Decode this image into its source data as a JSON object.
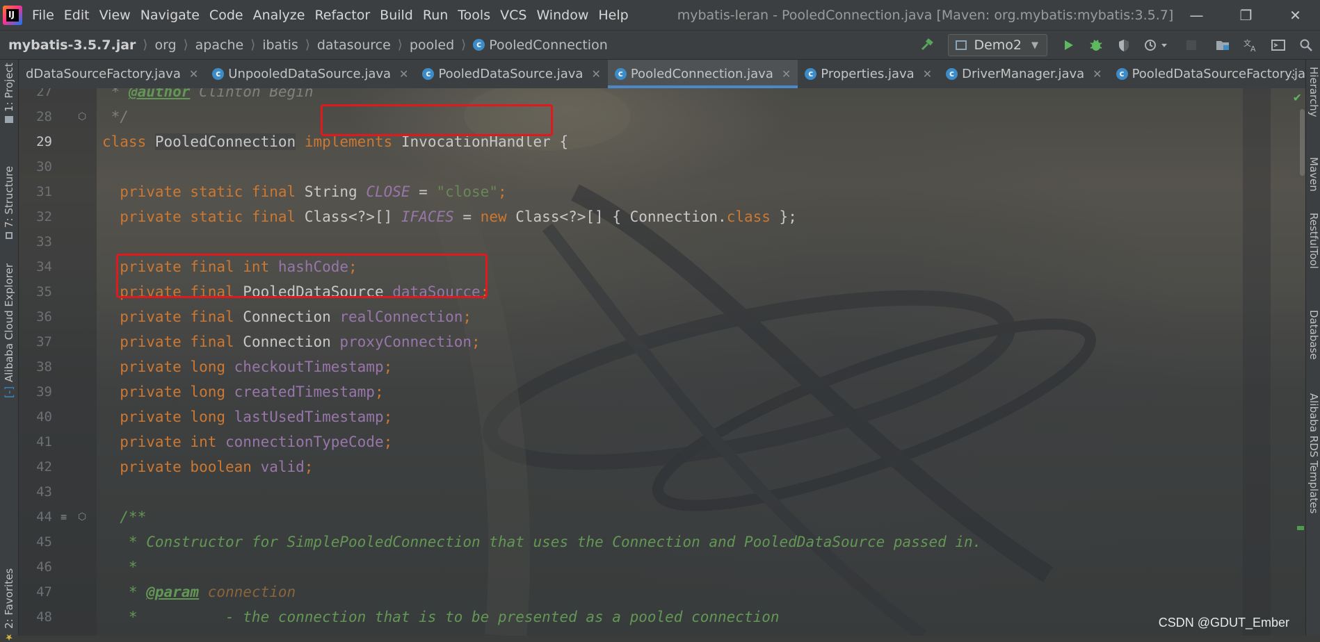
{
  "app": {
    "logo_text": "IJ",
    "window_title": "mybatis-leran - PooledConnection.java [Maven: org.mybatis:mybatis:3.5.7]"
  },
  "menu": [
    "File",
    "Edit",
    "View",
    "Navigate",
    "Code",
    "Analyze",
    "Refactor",
    "Build",
    "Run",
    "Tools",
    "VCS",
    "Window",
    "Help"
  ],
  "window_controls": {
    "minimize": "—",
    "restore": "❐",
    "close": "✕"
  },
  "breadcrumb": [
    "mybatis-3.5.7.jar",
    "org",
    "apache",
    "ibatis",
    "datasource",
    "pooled",
    "PooledConnection"
  ],
  "toolbar": {
    "run_config": "Demo2"
  },
  "left_tool_tabs": [
    "1: Project",
    "7: Structure",
    "Alibaba Cloud Explorer",
    "2: Favorites"
  ],
  "right_tool_tabs": [
    "Hierarchy",
    "Maven",
    "RestfulTool",
    "Database",
    "Alibaba RDS Templates"
  ],
  "tabs": [
    {
      "label": "dDataSourceFactory.java",
      "active": false,
      "icon": false
    },
    {
      "label": "UnpooledDataSource.java",
      "active": false,
      "icon": true
    },
    {
      "label": "PooledDataSource.java",
      "active": false,
      "icon": true
    },
    {
      "label": "PooledConnection.java",
      "active": true,
      "icon": true
    },
    {
      "label": "Properties.java",
      "active": false,
      "icon": true
    },
    {
      "label": "DriverManager.java",
      "active": false,
      "icon": true
    },
    {
      "label": "PooledDataSourceFactory.ja",
      "active": false,
      "icon": true
    }
  ],
  "editor": {
    "current_line": 29,
    "lines": [
      {
        "n": "27",
        "parts": [
          [
            "dgray",
            " * "
          ],
          [
            "dtag",
            "@author"
          ],
          [
            "dgray",
            " Clinton Begin"
          ]
        ]
      },
      {
        "n": "28",
        "parts": [
          [
            "dgray",
            " */"
          ]
        ]
      },
      {
        "n": "29",
        "parts": [
          [
            "kw",
            "class "
          ],
          [
            "cls-name",
            "PooledConnection"
          ],
          [
            "plain",
            " "
          ],
          [
            "kw",
            "implements "
          ],
          [
            "ty",
            "InvocationHandler"
          ],
          [
            "plain",
            " {"
          ]
        ]
      },
      {
        "n": "30",
        "parts": []
      },
      {
        "n": "31",
        "parts": [
          [
            "kw",
            "  private static final "
          ],
          [
            "ty",
            "String "
          ],
          [
            "cst",
            "CLOSE"
          ],
          [
            "plain",
            " = "
          ],
          [
            "str",
            "\"close\""
          ],
          [
            "kw",
            ";"
          ]
        ]
      },
      {
        "n": "32",
        "parts": [
          [
            "kw",
            "  private static final "
          ],
          [
            "ty",
            "Class<?>[] "
          ],
          [
            "cst",
            "IFACES"
          ],
          [
            "plain",
            " = "
          ],
          [
            "kw",
            "new "
          ],
          [
            "ty",
            "Class<?>[] { Connection."
          ],
          [
            "kw",
            "class"
          ],
          [
            "plain",
            " };"
          ]
        ]
      },
      {
        "n": "33",
        "parts": []
      },
      {
        "n": "34",
        "parts": [
          [
            "kw",
            "  private final int "
          ],
          [
            "fld",
            "hashCode"
          ],
          [
            "kw",
            ";"
          ]
        ]
      },
      {
        "n": "35",
        "parts": [
          [
            "kw",
            "  private final "
          ],
          [
            "ty",
            "PooledDataSource "
          ],
          [
            "fld",
            "dataSource"
          ],
          [
            "kw",
            ";"
          ]
        ]
      },
      {
        "n": "36",
        "parts": [
          [
            "kw",
            "  private final "
          ],
          [
            "ty",
            "Connection "
          ],
          [
            "fld",
            "realConnection"
          ],
          [
            "kw",
            ";"
          ]
        ]
      },
      {
        "n": "37",
        "parts": [
          [
            "kw",
            "  private final "
          ],
          [
            "ty",
            "Connection "
          ],
          [
            "fld",
            "proxyConnection"
          ],
          [
            "kw",
            ";"
          ]
        ]
      },
      {
        "n": "38",
        "parts": [
          [
            "kw",
            "  private long "
          ],
          [
            "fld",
            "checkoutTimestamp"
          ],
          [
            "kw",
            ";"
          ]
        ]
      },
      {
        "n": "39",
        "parts": [
          [
            "kw",
            "  private long "
          ],
          [
            "fld",
            "createdTimestamp"
          ],
          [
            "kw",
            ";"
          ]
        ]
      },
      {
        "n": "40",
        "parts": [
          [
            "kw",
            "  private long "
          ],
          [
            "fld",
            "lastUsedTimestamp"
          ],
          [
            "kw",
            ";"
          ]
        ]
      },
      {
        "n": "41",
        "parts": [
          [
            "kw",
            "  private int "
          ],
          [
            "fld",
            "connectionTypeCode"
          ],
          [
            "kw",
            ";"
          ]
        ]
      },
      {
        "n": "42",
        "parts": [
          [
            "kw",
            "  private boolean "
          ],
          [
            "fld",
            "valid"
          ],
          [
            "kw",
            ";"
          ]
        ]
      },
      {
        "n": "43",
        "parts": []
      },
      {
        "n": "44",
        "parts": [
          [
            "doc",
            "  /**"
          ]
        ]
      },
      {
        "n": "45",
        "parts": [
          [
            "doc",
            "   * Constructor for SimplePooledConnection that uses the Connection and PooledDataSource passed in."
          ]
        ]
      },
      {
        "n": "46",
        "parts": [
          [
            "doc",
            "   *"
          ]
        ]
      },
      {
        "n": "47",
        "parts": [
          [
            "doc",
            "   * "
          ],
          [
            "dtag",
            "@param"
          ],
          [
            "doc",
            " "
          ],
          [
            "dparam",
            "connection"
          ]
        ]
      },
      {
        "n": "48",
        "parts": [
          [
            "doc",
            "   *          - the connection that is to be presented as a pooled connection"
          ]
        ]
      }
    ]
  },
  "colors": {
    "keyword": "#cc7832",
    "field": "#9876aa",
    "string": "#6a8759",
    "doc": "#629755",
    "highlight_box": "#e0191d",
    "active_tab_underline": "#4a88c7"
  },
  "watermark": "CSDN @GDUT_Ember"
}
